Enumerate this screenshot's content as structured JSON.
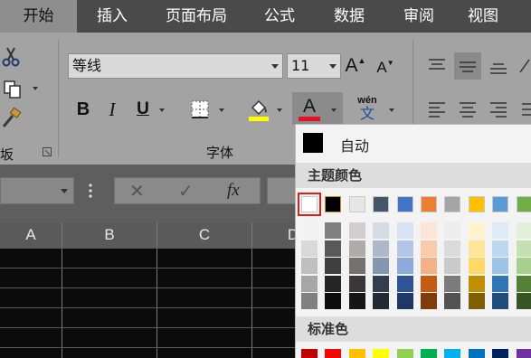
{
  "tabs": [
    {
      "label": "开始",
      "active": true
    },
    {
      "label": "插入",
      "active": false
    },
    {
      "label": "页面布局",
      "active": false
    },
    {
      "label": "公式",
      "active": false
    },
    {
      "label": "数据",
      "active": false
    },
    {
      "label": "审阅",
      "active": false
    },
    {
      "label": "视图",
      "active": false
    }
  ],
  "ribbon": {
    "font_name": "等线",
    "font_size": "11",
    "grow_font_label": "A",
    "shrink_font_label": "A",
    "bold_label": "B",
    "italic_label": "I",
    "underline_label": "U",
    "font_color_label": "A",
    "phonetic_top": "wén",
    "phonetic_bottom": "文",
    "font_group_label": "字体",
    "clipboard_group_label_partial": "坂",
    "font_color_bar": "#e81123",
    "fill_color_bar": "#ffff00"
  },
  "formula_bar": {
    "cancel_label": "✕",
    "confirm_label": "✓",
    "fx_label": "fx"
  },
  "sheet": {
    "columns": [
      "A",
      "B",
      "C",
      "D"
    ]
  },
  "color_picker": {
    "automatic_label": "自动",
    "theme_title": "主题颜色",
    "standard_title": "标准色",
    "selected": "theme-white",
    "theme_colors": [
      "#ffffff",
      "#000000",
      "#e7e6e6",
      "#44546a",
      "#4472c4",
      "#ed7d31",
      "#a5a5a5",
      "#ffc000",
      "#5b9bd5",
      "#70ad47"
    ],
    "theme_shades": [
      [
        "#f2f2f2",
        "#d9d9d9",
        "#bfbfbf",
        "#a6a6a6",
        "#808080"
      ],
      [
        "#808080",
        "#595959",
        "#404040",
        "#262626",
        "#0d0d0d"
      ],
      [
        "#d0cece",
        "#aeabab",
        "#757171",
        "#3a3838",
        "#171616"
      ],
      [
        "#d6dce4",
        "#adb9ca",
        "#8497b0",
        "#333f4f",
        "#222a35"
      ],
      [
        "#d9e2f3",
        "#b4c6e7",
        "#8eaadb",
        "#2f5496",
        "#1f3864"
      ],
      [
        "#fbe5d5",
        "#f7cbac",
        "#f4b183",
        "#c55a11",
        "#823b0b"
      ],
      [
        "#ededed",
        "#dbdbdb",
        "#c9c9c9",
        "#7b7b7b",
        "#525252"
      ],
      [
        "#fff2cc",
        "#fee599",
        "#ffd965",
        "#bf8f00",
        "#7f6000"
      ],
      [
        "#deebf6",
        "#bdd7ee",
        "#9dc3e6",
        "#2e75b5",
        "#1e4e79"
      ],
      [
        "#e2efd9",
        "#c5e0b3",
        "#a8d08d",
        "#538135",
        "#375623"
      ]
    ],
    "standard_colors": [
      "#c00000",
      "#ff0000",
      "#ffc000",
      "#ffff00",
      "#92d050",
      "#00b050",
      "#00b0f0",
      "#0070c0",
      "#002060",
      "#7030a0"
    ]
  }
}
